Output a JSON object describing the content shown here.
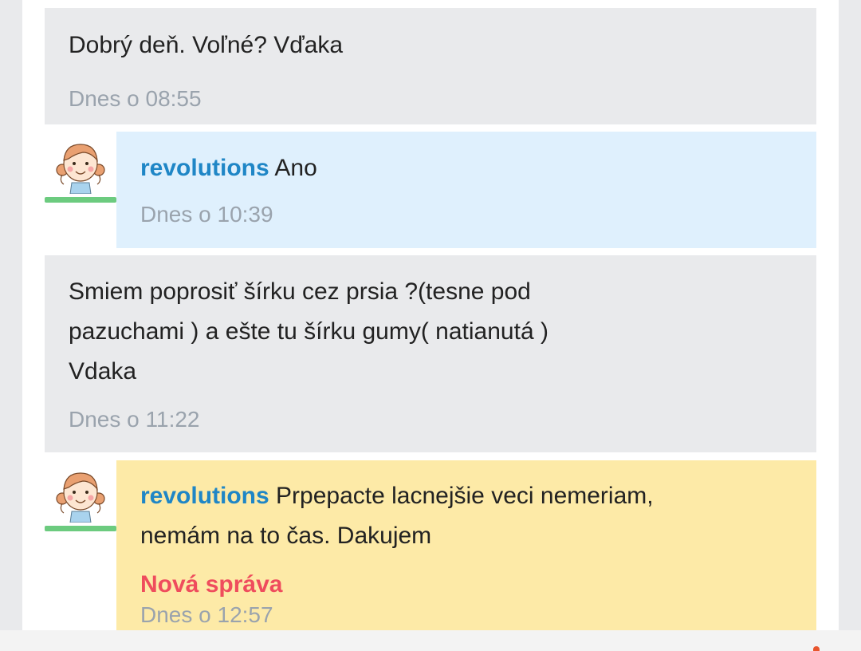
{
  "messages": [
    {
      "kind": "outgoing",
      "text": "Dobrý deň. Voľné? Vďaka",
      "time": "Dnes o 08:55"
    },
    {
      "kind": "incoming",
      "author": "revolutions",
      "text": " Ano",
      "time": "Dnes o 10:39",
      "avatar": "girl-avatar-icon"
    },
    {
      "kind": "outgoing",
      "lines": [
        "Smiem poprosiť šírku cez prsia ?(tesne pod",
        "pazuchami ) a ešte tu šírku gumy( natianutá )",
        "Vdaka"
      ],
      "time": "Dnes o 11:22"
    },
    {
      "kind": "incoming",
      "author": "revolutions",
      "text_line1": " Prpepacte lacnejšie veci nemeriam,",
      "text_line2": "nemám na to čas. Dakujem",
      "new_label": "Nová správa",
      "time": "Dnes o 12:57",
      "avatar": "girl-avatar-icon"
    }
  ],
  "colors": {
    "author": "#1f86c6",
    "new_label": "#ef4c5d",
    "incoming_read_bg": "#dff0fd",
    "incoming_new_bg": "#fdeaa7",
    "outgoing_bg": "#e9eaec"
  }
}
